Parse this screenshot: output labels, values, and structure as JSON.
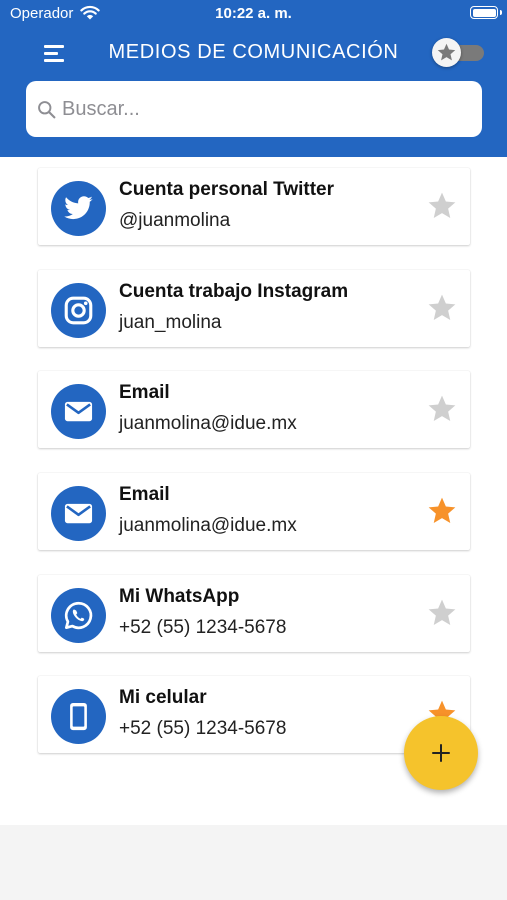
{
  "status_bar": {
    "carrier": "Operador",
    "time": "10:22 a. m.",
    "wifi_icon": "wifi-icon",
    "battery_icon": "battery-icon"
  },
  "header": {
    "title": "MEDIOS DE COMUNICACIÓN",
    "menu_icon": "menu-icon",
    "favorites_toggle": {
      "icon": "star-icon",
      "on": false
    }
  },
  "search": {
    "placeholder": "Buscar...",
    "value": "",
    "icon": "search-icon"
  },
  "contacts": [
    {
      "icon": "twitter-icon",
      "title": "Cuenta personal Twitter",
      "value": "@juanmolina",
      "favorite": false
    },
    {
      "icon": "instagram-icon",
      "title": "Cuenta trabajo Instagram",
      "value": "juan_molina",
      "favorite": false
    },
    {
      "icon": "email-icon",
      "title": "Email",
      "value": "juanmolina@idue.mx",
      "favorite": false
    },
    {
      "icon": "email-icon",
      "title": "Email",
      "value": "juanmolina@idue.mx",
      "favorite": true
    },
    {
      "icon": "whatsapp-icon",
      "title": "Mi WhatsApp",
      "value": "+52 (55) 1234-5678",
      "favorite": false
    },
    {
      "icon": "phone-icon",
      "title": "Mi celular",
      "value": "+52 (55) 1234-5678",
      "favorite": true
    }
  ],
  "fab": {
    "icon": "plus-icon"
  },
  "colors": {
    "primary": "#2366c1",
    "favorite_star": "#f7922a",
    "inactive_star": "#cfcfcf",
    "fab": "#f5c32c"
  }
}
